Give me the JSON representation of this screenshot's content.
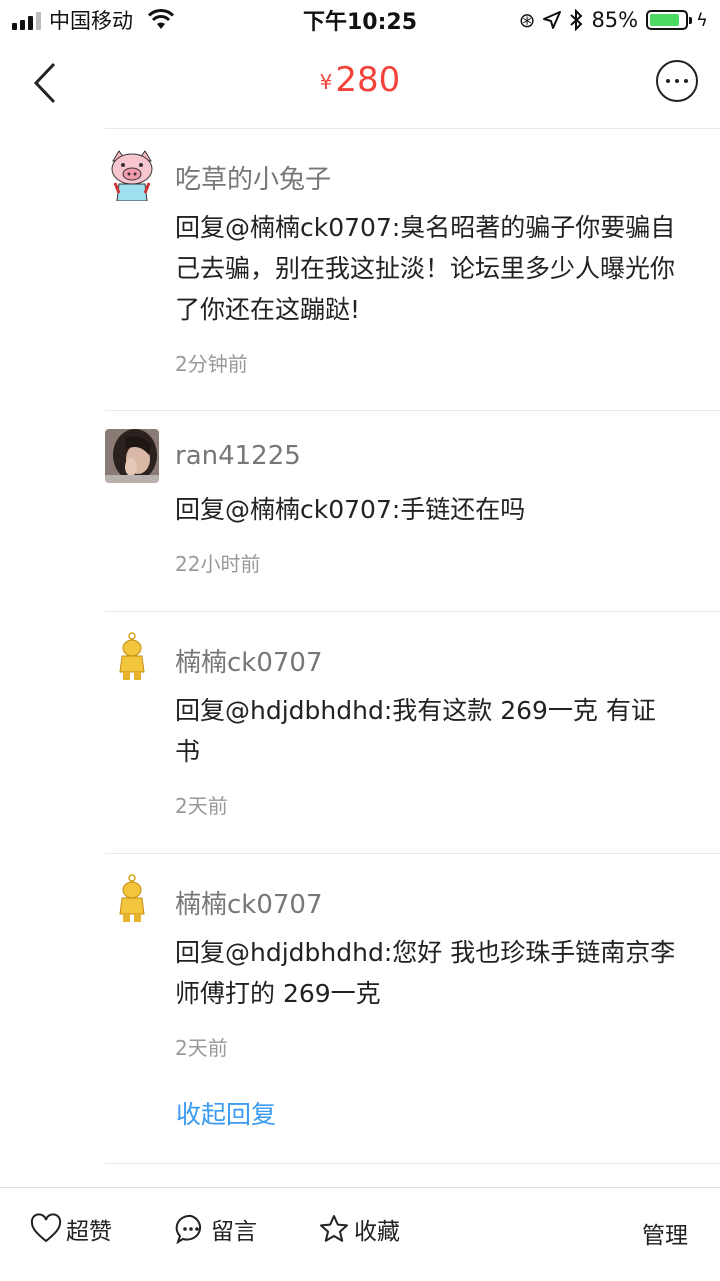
{
  "status_bar": {
    "carrier": "中国移动",
    "time": "下午10:25",
    "battery_percent": "85%",
    "battery_level": 0.85,
    "battery_color": "#4cd964"
  },
  "nav": {
    "currency": "¥",
    "price": "280",
    "price_color": "#f2433b",
    "back_icon": "chevron-left-icon",
    "more_icon": "more-dots-icon"
  },
  "comments": [
    {
      "username": "吃草的小兔子",
      "text": "回复@楠楠ck0707:臭名昭著的骗子你要骗自己去骗，别在我这扯淡！论坛里多少人曝光你了你还在这蹦跶!",
      "time": "2分钟前"
    },
    {
      "username": "ran41225",
      "text": "回复@楠楠ck0707:手链还在吗",
      "time": "22小时前"
    },
    {
      "username": "楠楠ck0707",
      "text": "回复@hdjdbhdhd:我有这款 269一克 有证书",
      "time": "2天前"
    },
    {
      "username": "楠楠ck0707",
      "text": "回复@hdjdbhdhd:您好 我也珍珠手链南京李师傅打的 269一克",
      "time": "2天前"
    }
  ],
  "collapse_label": "收起回复",
  "link_color": "#3a9bf0",
  "bottom_bar": {
    "like_label": "超赞",
    "comment_label": "留言",
    "favorite_label": "收藏",
    "manage_label": "管理"
  }
}
